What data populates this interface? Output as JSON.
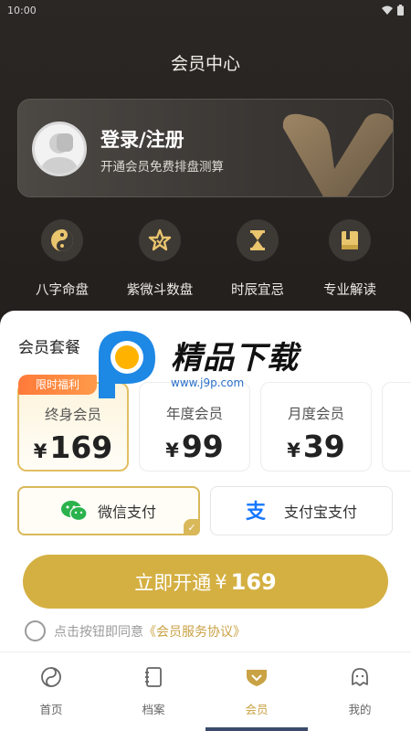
{
  "status": {
    "time": "10:00"
  },
  "header": {
    "title": "会员中心"
  },
  "profile": {
    "title": "登录/注册",
    "subtitle": "开通会员免费排盘测算"
  },
  "features": [
    {
      "label": "八字命盘",
      "icon": "yin-yang-icon"
    },
    {
      "label": "紫微斗数盘",
      "icon": "star-icon"
    },
    {
      "label": "时辰宜忌",
      "icon": "hourglass-icon"
    },
    {
      "label": "专业解读",
      "icon": "book-icon"
    }
  ],
  "plans": {
    "title": "会员套餐",
    "badge": "限时福利",
    "items": [
      {
        "name": "终身会员",
        "currency": "¥",
        "price": "169",
        "selected": true
      },
      {
        "name": "年度会员",
        "currency": "¥",
        "price": "99"
      },
      {
        "name": "月度会员",
        "currency": "¥",
        "price": "39"
      }
    ]
  },
  "payment": {
    "wechat": "微信支付",
    "alipay": "支付宝支付"
  },
  "cta": {
    "label": "立即开通",
    "currency": "¥",
    "price": "169"
  },
  "agreement": {
    "text": "点击按钮即同意",
    "link": "《会员服务协议》"
  },
  "watermark": {
    "text": "精品下载",
    "url": "www.j9p.com"
  },
  "tabs": [
    {
      "label": "首页",
      "icon": "yin-yang-icon"
    },
    {
      "label": "档案",
      "icon": "notebook-icon"
    },
    {
      "label": "会员",
      "icon": "crown-heart-icon",
      "active": true
    },
    {
      "label": "我的",
      "icon": "ghost-icon"
    }
  ],
  "colors": {
    "accent": "#d4b042",
    "dark_bg": "#2a2623",
    "badge": "#ff7a3a"
  }
}
